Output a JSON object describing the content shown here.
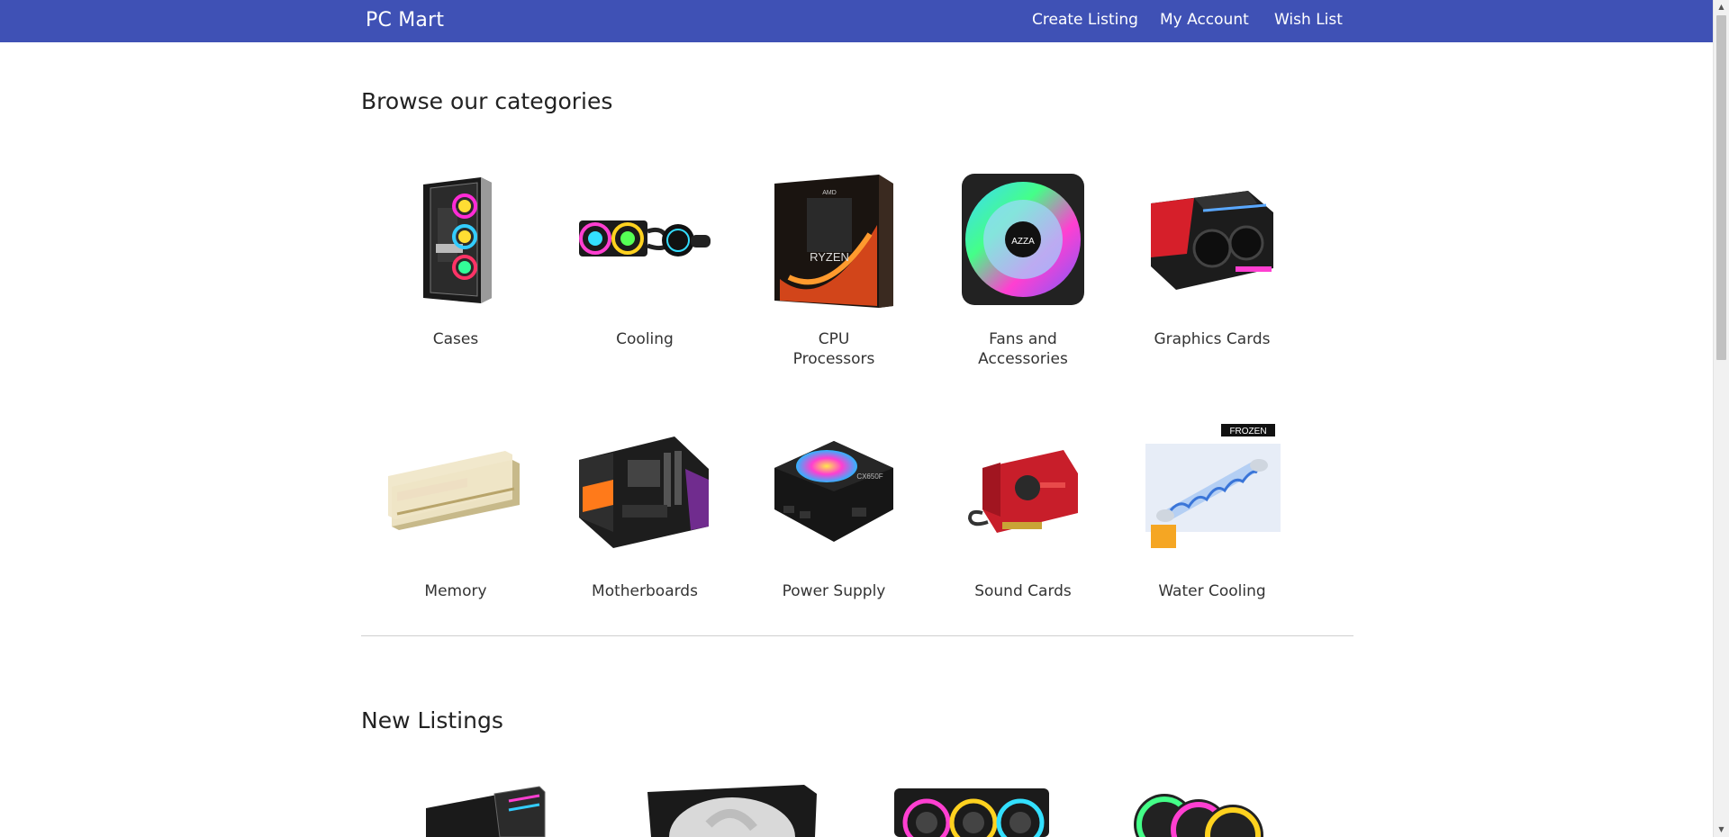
{
  "nav": {
    "brand": "PC Mart",
    "links": [
      "Create Listing",
      "My Account",
      "Wish List"
    ]
  },
  "categories_section": {
    "title": "Browse our categories",
    "items": [
      {
        "label": "Cases",
        "icon": "pc-case-image"
      },
      {
        "label": "Cooling",
        "icon": "aio-cooler-image"
      },
      {
        "label": "CPU Processors",
        "icon": "cpu-box-image"
      },
      {
        "label": "Fans and Accessories",
        "icon": "rgb-fan-image"
      },
      {
        "label": "Graphics Cards",
        "icon": "graphics-card-image"
      },
      {
        "label": "Memory",
        "icon": "ram-sticks-image"
      },
      {
        "label": "Motherboards",
        "icon": "motherboard-image"
      },
      {
        "label": "Power Supply",
        "icon": "psu-image"
      },
      {
        "label": "Sound Cards",
        "icon": "sound-card-image"
      },
      {
        "label": "Water Cooling",
        "icon": "water-tube-image"
      }
    ]
  },
  "listings_section": {
    "title": "New Listings",
    "items": [
      {
        "icon": "listing-case-image"
      },
      {
        "icon": "listing-fan-image"
      },
      {
        "icon": "listing-triple-fan-image"
      },
      {
        "icon": "listing-fan-pack-image"
      }
    ]
  },
  "colors": {
    "nav_bg": "#3f51b5",
    "text": "#222222",
    "divider": "#cfcfcf"
  }
}
